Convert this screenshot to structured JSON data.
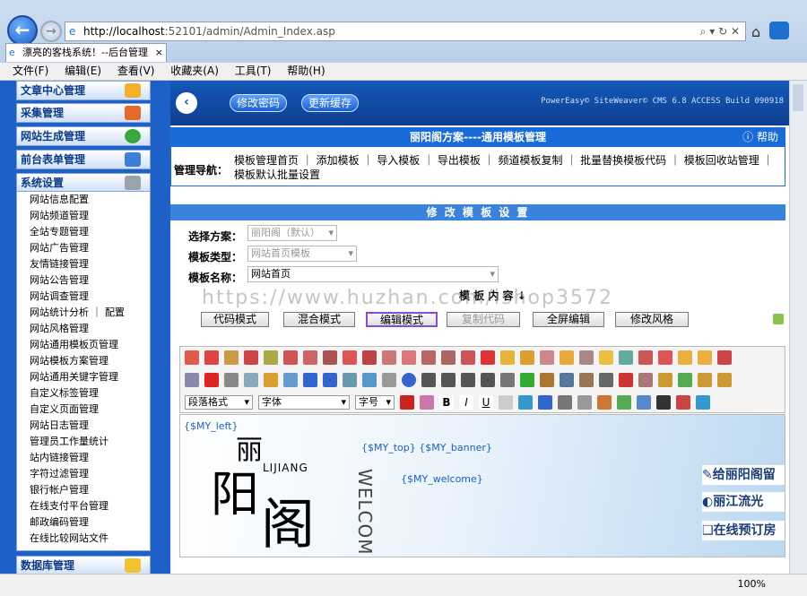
{
  "browser": {
    "url_host": "http://localhost",
    "url_rest": ":52101/admin/Admin_Index.asp",
    "tab_title": "漂亮的客栈系统！--后台管理",
    "menu": [
      "文件(F)",
      "编辑(E)",
      "查看(V)",
      "收藏夹(A)",
      "工具(T)",
      "帮助(H)"
    ],
    "zoom": "100%"
  },
  "sidebar": {
    "sections": [
      "文章中心管理",
      "采集管理",
      "网站生成管理",
      "前台表单管理",
      "系统设置"
    ],
    "items": [
      "网站信息配置",
      "网站频道管理",
      "全站专题管理",
      "网站广告管理",
      "友情链接管理",
      "网站公告管理",
      "网站调查管理",
      "网站统计分析 ｜ 配置",
      "网站风格管理",
      "网站通用模板页管理",
      "网站模板方案管理",
      "网站通用关键字管理",
      "自定义标签管理",
      "自定义页面管理",
      "网站日志管理",
      "管理员工作量统计",
      "站内链接管理",
      "字符过滤管理",
      "银行帐户管理",
      "在线支付平台管理",
      "邮政编码管理",
      "在线比较网站文件"
    ],
    "bottom_section": "数据库管理"
  },
  "top": {
    "btn_password": "修改密码",
    "btn_cache": "更新缓存",
    "version": "PowerEasy© SiteWeaver© CMS 6.8 ACCESS Build 090918"
  },
  "panel": {
    "title": "丽阳阁方案----通用模板管理",
    "help": "帮助",
    "nav_label": "管理导航：",
    "nav_links": "模板管理首页 ｜ 添加模板 ｜ 导入模板 ｜ 导出模板 ｜ 频道模板复制 ｜ 批量替换模板代码 ｜ 模板回收站管理 ｜ 模板默认批量设置"
  },
  "form": {
    "title": "修 改 模 板 设 置",
    "scheme_label": "选择方案：",
    "scheme_value": "丽阳阁（默认）",
    "type_label": "模板类型：",
    "type_value": "网站首页模板",
    "name_label": "模板名称：",
    "name_value": "网站首页",
    "content_label": "模 板 内 容 ↓",
    "watermark": "https://www.huzhan.com/ishop3572"
  },
  "modes": [
    "代码模式",
    "混合模式",
    "编辑模式",
    "复制代码",
    "全屏编辑",
    "修改风格"
  ],
  "toolbar": {
    "paragraph": "段落格式",
    "font": "字体",
    "size": "字号"
  },
  "editor": {
    "tag_left": "{$MY_left}",
    "tag_top": "{$MY_top} {$MY_banner}",
    "tag_welcome": "{$MY_welcome}",
    "logo_char1": "丽",
    "logo_char2": "阳",
    "logo_char3": "阁",
    "logo_latin": "LIJIANG",
    "welcome_vertical": "WELCOM",
    "right_items": [
      "给丽阳阁留",
      "丽江流光",
      "在线预订房"
    ]
  }
}
